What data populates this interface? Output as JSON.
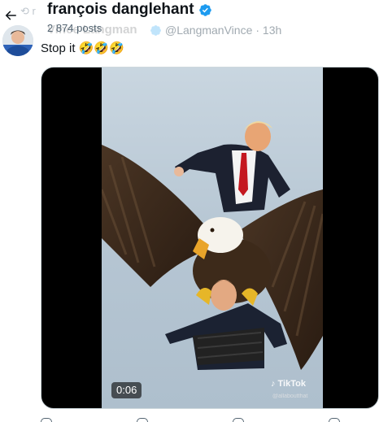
{
  "header": {
    "title": "françois danglehant",
    "post_count": "2 874 posts"
  },
  "retweet": {
    "label": "r",
    "author_name": "Vince Langman",
    "author_handle": "@LangmanVince",
    "time": "· 13h"
  },
  "tweet": {
    "text": "Stop it 🤣🤣🤣"
  },
  "video": {
    "duration": "0:06",
    "watermark": "TikTok",
    "watermark_handle": "@allaboutthat"
  },
  "colors": {
    "verified": "#1d9bf0",
    "text_primary": "#0f1419",
    "text_secondary": "#536471",
    "border": "#cfd9de"
  },
  "icons": {
    "back": "arrow-left-icon",
    "verified": "verified-badge-icon",
    "retweet": "retweet-icon"
  }
}
